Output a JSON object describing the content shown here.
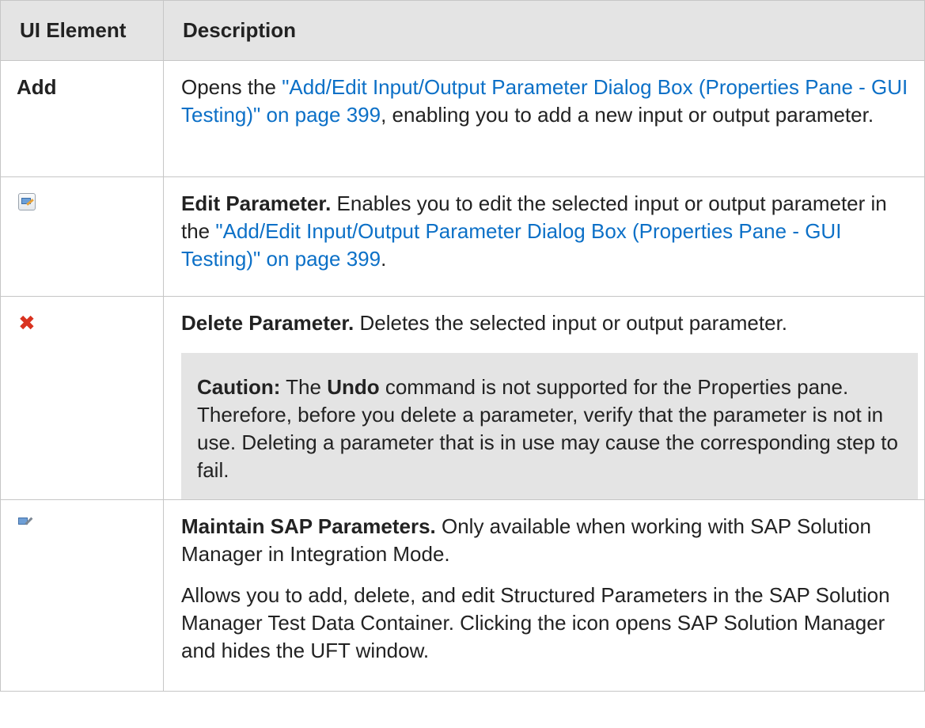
{
  "header": {
    "col_ui_element": "UI Element",
    "col_description": "Description"
  },
  "rows": [
    {
      "element_label": "Add",
      "desc_before": "Opens the ",
      "link": "\"Add/Edit Input/Output Parameter Dialog Box (Properties Pane - GUI Testing)\" on page 399",
      "desc_after": ", enabling you to add a new input or output parameter."
    },
    {
      "icon": "edit-parameter-icon",
      "title": "Edit Parameter.",
      "desc_before": " Enables you to edit the selected input or output parameter in the ",
      "link": "\"Add/Edit Input/Output Parameter Dialog Box (Properties Pane - GUI Testing)\" on page 399",
      "desc_after": "."
    },
    {
      "icon": "delete-parameter-icon",
      "title": "Delete Parameter.",
      "desc": " Deletes the selected input or output parameter.",
      "caution": {
        "label": "Caution:",
        "text_before": " The ",
        "command": "Undo",
        "text_after": " command is not supported for the Properties pane. Therefore, before you delete a parameter, verify that the parameter is not in use. Deleting a parameter that is in use may cause the corresponding step to fail."
      }
    },
    {
      "icon": "sap-parameters-icon",
      "title": "Maintain SAP Parameters.",
      "desc": " Only available when working with SAP Solution Manager in Integration Mode.",
      "para2": "Allows you to add, delete, and edit Structured Parameters in the SAP Solution Manager Test Data Container. Clicking the icon opens SAP Solution Manager and hides the UFT window."
    }
  ]
}
